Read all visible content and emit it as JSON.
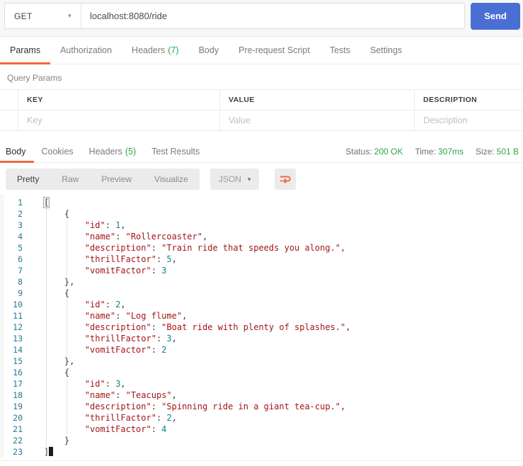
{
  "request": {
    "method": "GET",
    "url": "localhost:8080/ride",
    "send_label": "Send"
  },
  "request_tabs": [
    {
      "label": "Params",
      "active": true
    },
    {
      "label": "Authorization"
    },
    {
      "label": "Headers",
      "count": "(7)"
    },
    {
      "label": "Body"
    },
    {
      "label": "Pre-request Script"
    },
    {
      "label": "Tests"
    },
    {
      "label": "Settings"
    }
  ],
  "query_params": {
    "section_title": "Query Params",
    "columns": [
      "KEY",
      "VALUE",
      "DESCRIPTION"
    ],
    "placeholders": [
      "Key",
      "Value",
      "Description"
    ]
  },
  "response": {
    "tabs": [
      {
        "label": "Body",
        "active": true
      },
      {
        "label": "Cookies"
      },
      {
        "label": "Headers",
        "count": "(5)"
      },
      {
        "label": "Test Results"
      }
    ],
    "meta": [
      {
        "label": "Status:",
        "value": "200 OK"
      },
      {
        "label": "Time:",
        "value": "307ms"
      },
      {
        "label": "Size:",
        "value": "501 B"
      }
    ]
  },
  "viewer": {
    "modes": [
      "Pretty",
      "Raw",
      "Preview",
      "Visualize"
    ],
    "active_mode": "Pretty",
    "language": "JSON",
    "wrap_icon": "wrap-text-icon"
  },
  "response_body": {
    "lines": [
      "[",
      "    {",
      "        \"id\": 1,",
      "        \"name\": \"Rollercoaster\",",
      "        \"description\": \"Train ride that speeds you along.\",",
      "        \"thrillFactor\": 5,",
      "        \"vomitFactor\": 3",
      "    },",
      "    {",
      "        \"id\": 2,",
      "        \"name\": \"Log flume\",",
      "        \"description\": \"Boat ride with plenty of splashes.\",",
      "        \"thrillFactor\": 3,",
      "        \"vomitFactor\": 2",
      "    },",
      "    {",
      "        \"id\": 3,",
      "        \"name\": \"Teacups\",",
      "        \"description\": \"Spinning ride in a giant tea-cup.\",",
      "        \"thrillFactor\": 2,",
      "        \"vomitFactor\": 4",
      "    }",
      "]"
    ]
  },
  "colors": {
    "accent_orange": "#ed6b3d",
    "status_green": "#27a746",
    "tab_count_green": "#27a746",
    "send_blue": "#4a6fd4",
    "code_string": "#a31515",
    "code_number": "#0b8793",
    "code_line_number": "#237893"
  }
}
